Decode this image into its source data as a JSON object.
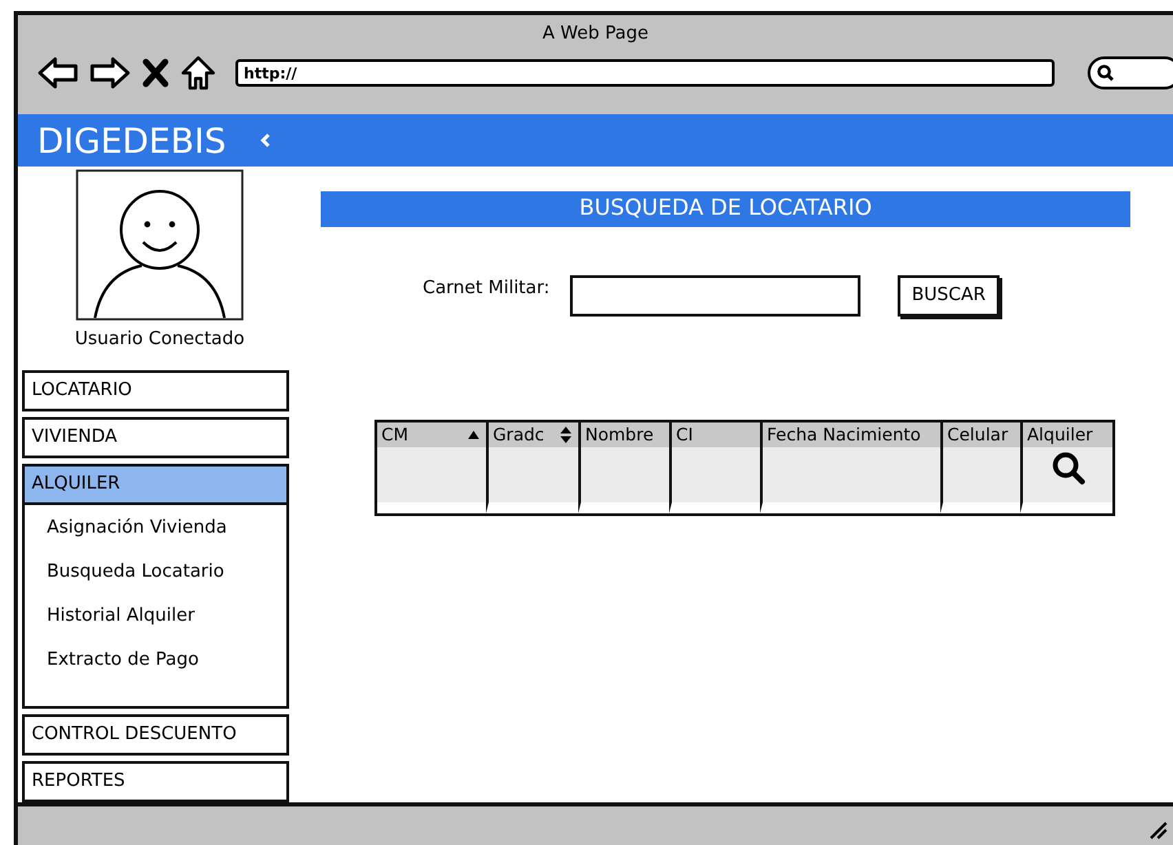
{
  "window": {
    "title": "A Web Page",
    "url": "http://"
  },
  "header": {
    "brand": "DIGEDEBIS"
  },
  "sidebar": {
    "user_label": "Usuario Conectado",
    "items": [
      {
        "label": "LOCATARIO",
        "selected": false
      },
      {
        "label": "VIVIENDA",
        "selected": false
      },
      {
        "label": "ALQUILER",
        "selected": true,
        "expanded": true,
        "children": [
          {
            "label": "Asignación Vivienda"
          },
          {
            "label": "Busqueda Locatario"
          },
          {
            "label": "Historial Alquiler"
          },
          {
            "label": "Extracto de Pago"
          }
        ]
      },
      {
        "label": "CONTROL DESCUENTO",
        "selected": false
      },
      {
        "label": "REPORTES",
        "selected": false
      }
    ]
  },
  "main": {
    "title": "BUSQUEDA DE LOCATARIO",
    "field_label": "Carnet Militar:",
    "button": "BUSCAR",
    "table": {
      "columns": [
        {
          "label": "CM",
          "sortable": true,
          "sorted": true,
          "kind": "text"
        },
        {
          "label": "Gradc",
          "sortable": true,
          "sorted": false,
          "kind": "text"
        },
        {
          "label": "Nombre",
          "sortable": false,
          "sorted": false,
          "kind": "text"
        },
        {
          "label": "CI",
          "sortable": false,
          "sorted": false,
          "kind": "text"
        },
        {
          "label": "Fecha Nacimiento",
          "sortable": false,
          "sorted": false,
          "kind": "text"
        },
        {
          "label": "Celular",
          "sortable": false,
          "sorted": false,
          "kind": "text"
        },
        {
          "label": "Alquiler",
          "sortable": false,
          "sorted": false,
          "kind": "action"
        }
      ]
    }
  }
}
